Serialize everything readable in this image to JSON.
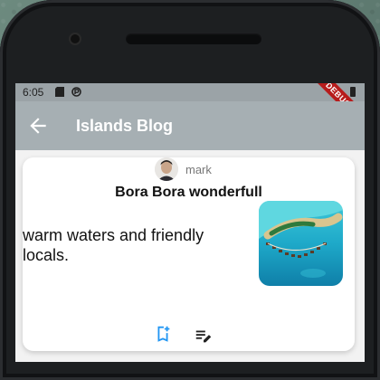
{
  "status_bar": {
    "time": "6:05",
    "debug_label": "DEBUG"
  },
  "app_bar": {
    "title": "Islands Blog",
    "back_icon": "arrow-back-icon",
    "color": "#a6afb3"
  },
  "post": {
    "author": "mark",
    "title": "Bora Bora wonderfull",
    "body": "warm waters and friendly locals.",
    "image_icon": "island-photo"
  },
  "actions": {
    "bookmark_icon": "bookmark-add-icon",
    "edit_icon": "edit-note-icon",
    "bookmark_color": "#2196f3"
  }
}
